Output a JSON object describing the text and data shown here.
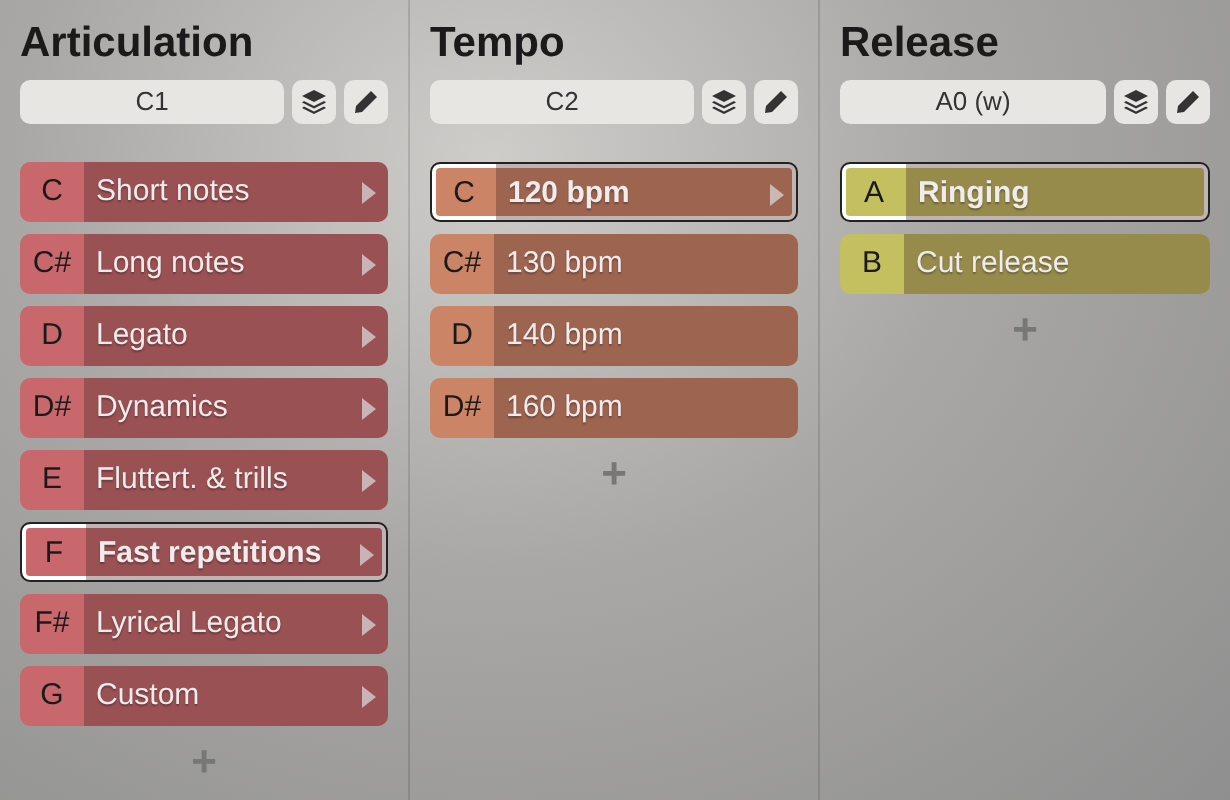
{
  "columns": [
    {
      "title": "Articulation",
      "field": "C1",
      "color": "#c8686c",
      "add": "+",
      "items": [
        {
          "key": "C",
          "label": "Short notes",
          "selected": false,
          "arrow": true
        },
        {
          "key": "C#",
          "label": "Long notes",
          "selected": false,
          "arrow": true
        },
        {
          "key": "D",
          "label": "Legato",
          "selected": false,
          "arrow": true
        },
        {
          "key": "D#",
          "label": "Dynamics",
          "selected": false,
          "arrow": true
        },
        {
          "key": "E",
          "label": "Fluttert. & trills",
          "selected": false,
          "arrow": true
        },
        {
          "key": "F",
          "label": "Fast repetitions",
          "selected": true,
          "arrow": true
        },
        {
          "key": "F#",
          "label": "Lyrical Legato",
          "selected": false,
          "arrow": true
        },
        {
          "key": "G",
          "label": "Custom",
          "selected": false,
          "arrow": true
        }
      ]
    },
    {
      "title": "Tempo",
      "field": "C2",
      "color": "#cc8466",
      "add": "+",
      "items": [
        {
          "key": "C",
          "label": "120 bpm",
          "selected": true,
          "arrow": true
        },
        {
          "key": "C#",
          "label": "130 bpm",
          "selected": false,
          "arrow": false
        },
        {
          "key": "D",
          "label": "140 bpm",
          "selected": false,
          "arrow": false
        },
        {
          "key": "D#",
          "label": "160 bpm",
          "selected": false,
          "arrow": false
        }
      ]
    },
    {
      "title": "Release",
      "field": "A0 (w)",
      "color": "#c4c060",
      "add": "+",
      "items": [
        {
          "key": "A",
          "label": "Ringing",
          "selected": true,
          "arrow": false
        },
        {
          "key": "B",
          "label": "Cut release",
          "selected": false,
          "arrow": false
        }
      ]
    }
  ]
}
